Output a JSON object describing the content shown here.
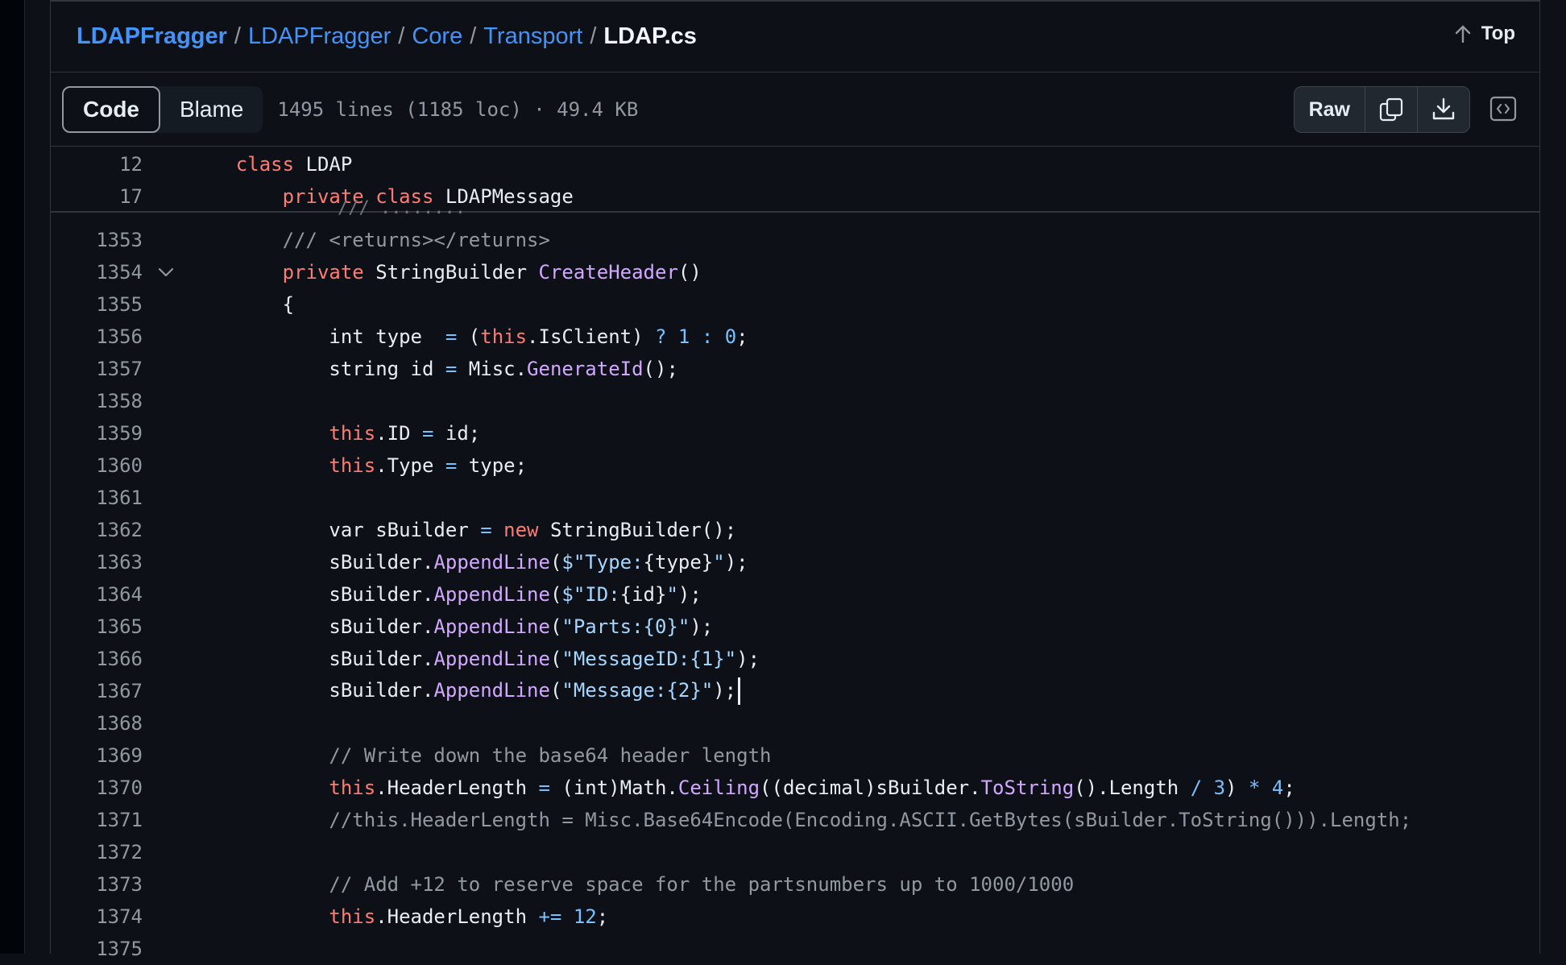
{
  "breadcrumb": {
    "items": [
      "LDAPFragger",
      "LDAPFragger",
      "Core",
      "Transport"
    ],
    "separator": "/",
    "current": "LDAP.cs"
  },
  "top_button": {
    "label": "Top",
    "icon": "arrow-up-icon"
  },
  "toolbar": {
    "tabs": [
      {
        "label": "Code",
        "active": true
      },
      {
        "label": "Blame",
        "active": false
      }
    ],
    "file_meta": "1495 lines (1185 loc) · 49.4 KB",
    "raw_label": "Raw",
    "icons": [
      "copy-icon",
      "download-icon",
      "code-embed-icon"
    ]
  },
  "colors": {
    "background": "#0d1117",
    "link": "#4493f8",
    "keyword": "#ff7b72",
    "function": "#d2a8ff",
    "string": "#a5d6ff",
    "number": "#79c0ff",
    "comment": "#9198a1"
  },
  "sticky_lines": [
    {
      "num": "12",
      "tokens": [
        {
          "t": "    "
        },
        {
          "t": "class",
          "c": "kw"
        },
        {
          "t": " LDAP"
        }
      ]
    },
    {
      "num": "17",
      "tokens": [
        {
          "t": "        "
        },
        {
          "t": "private class",
          "c": "kw"
        },
        {
          "t": " LDAPMessage"
        }
      ]
    }
  ],
  "code_lines": [
    {
      "num": "1353",
      "tokens": [
        {
          "t": "        "
        },
        {
          "t": "/// <returns></returns>",
          "c": "cm"
        }
      ]
    },
    {
      "num": "1354",
      "fold": true,
      "tokens": [
        {
          "t": "        "
        },
        {
          "t": "private",
          "c": "kw"
        },
        {
          "t": " StringBuilder "
        },
        {
          "t": "CreateHeader",
          "c": "fn"
        },
        {
          "t": "()"
        }
      ]
    },
    {
      "num": "1355",
      "tokens": [
        {
          "t": "        {"
        }
      ]
    },
    {
      "num": "1356",
      "tokens": [
        {
          "t": "            int type  "
        },
        {
          "t": "=",
          "c": "op"
        },
        {
          "t": " ("
        },
        {
          "t": "this",
          "c": "kw"
        },
        {
          "t": ".IsClient) "
        },
        {
          "t": "?",
          "c": "op"
        },
        {
          "t": " "
        },
        {
          "t": "1",
          "c": "num"
        },
        {
          "t": " "
        },
        {
          "t": ":",
          "c": "op"
        },
        {
          "t": " "
        },
        {
          "t": "0",
          "c": "num"
        },
        {
          "t": ";"
        }
      ]
    },
    {
      "num": "1357",
      "tokens": [
        {
          "t": "            string id "
        },
        {
          "t": "=",
          "c": "op"
        },
        {
          "t": " Misc."
        },
        {
          "t": "GenerateId",
          "c": "fn"
        },
        {
          "t": "();"
        }
      ]
    },
    {
      "num": "1358",
      "tokens": [
        {
          "t": ""
        }
      ]
    },
    {
      "num": "1359",
      "tokens": [
        {
          "t": "            "
        },
        {
          "t": "this",
          "c": "kw"
        },
        {
          "t": ".ID "
        },
        {
          "t": "=",
          "c": "op"
        },
        {
          "t": " id;"
        }
      ]
    },
    {
      "num": "1360",
      "tokens": [
        {
          "t": "            "
        },
        {
          "t": "this",
          "c": "kw"
        },
        {
          "t": ".Type "
        },
        {
          "t": "=",
          "c": "op"
        },
        {
          "t": " type;"
        }
      ]
    },
    {
      "num": "1361",
      "tokens": [
        {
          "t": ""
        }
      ]
    },
    {
      "num": "1362",
      "tokens": [
        {
          "t": "            var sBuilder "
        },
        {
          "t": "=",
          "c": "op"
        },
        {
          "t": " "
        },
        {
          "t": "new",
          "c": "kw"
        },
        {
          "t": " StringBuilder();"
        }
      ]
    },
    {
      "num": "1363",
      "tokens": [
        {
          "t": "            sBuilder."
        },
        {
          "t": "AppendLine",
          "c": "fn"
        },
        {
          "t": "("
        },
        {
          "t": "$\"Type:",
          "c": "str"
        },
        {
          "t": "{type}"
        },
        {
          "t": "\"",
          "c": "str"
        },
        {
          "t": ");"
        }
      ]
    },
    {
      "num": "1364",
      "tokens": [
        {
          "t": "            sBuilder."
        },
        {
          "t": "AppendLine",
          "c": "fn"
        },
        {
          "t": "("
        },
        {
          "t": "$\"ID:",
          "c": "str"
        },
        {
          "t": "{id}"
        },
        {
          "t": "\"",
          "c": "str"
        },
        {
          "t": ");"
        }
      ]
    },
    {
      "num": "1365",
      "tokens": [
        {
          "t": "            sBuilder."
        },
        {
          "t": "AppendLine",
          "c": "fn"
        },
        {
          "t": "("
        },
        {
          "t": "\"Parts:{0}\"",
          "c": "str"
        },
        {
          "t": ");"
        }
      ]
    },
    {
      "num": "1366",
      "tokens": [
        {
          "t": "            sBuilder."
        },
        {
          "t": "AppendLine",
          "c": "fn"
        },
        {
          "t": "("
        },
        {
          "t": "\"MessageID:{1}\"",
          "c": "str"
        },
        {
          "t": ");"
        }
      ]
    },
    {
      "num": "1367",
      "caret": true,
      "tokens": [
        {
          "t": "            sBuilder."
        },
        {
          "t": "AppendLine",
          "c": "fn"
        },
        {
          "t": "("
        },
        {
          "t": "\"Message:{2}\"",
          "c": "str"
        },
        {
          "t": ");"
        }
      ]
    },
    {
      "num": "1368",
      "tokens": [
        {
          "t": ""
        }
      ]
    },
    {
      "num": "1369",
      "tokens": [
        {
          "t": "            "
        },
        {
          "t": "// Write down the base64 header length",
          "c": "cm"
        }
      ]
    },
    {
      "num": "1370",
      "tokens": [
        {
          "t": "            "
        },
        {
          "t": "this",
          "c": "kw"
        },
        {
          "t": ".HeaderLength "
        },
        {
          "t": "=",
          "c": "op"
        },
        {
          "t": " (int)Math."
        },
        {
          "t": "Ceiling",
          "c": "fn"
        },
        {
          "t": "((decimal)sBuilder."
        },
        {
          "t": "ToString",
          "c": "fn"
        },
        {
          "t": "().Length "
        },
        {
          "t": "/",
          "c": "op"
        },
        {
          "t": " "
        },
        {
          "t": "3",
          "c": "num"
        },
        {
          "t": ") "
        },
        {
          "t": "*",
          "c": "op"
        },
        {
          "t": " "
        },
        {
          "t": "4",
          "c": "num"
        },
        {
          "t": ";"
        }
      ]
    },
    {
      "num": "1371",
      "tokens": [
        {
          "t": "            "
        },
        {
          "t": "//this.HeaderLength = Misc.Base64Encode(Encoding.ASCII.GetBytes(sBuilder.ToString())).Length;",
          "c": "cm"
        }
      ]
    },
    {
      "num": "1372",
      "tokens": [
        {
          "t": ""
        }
      ]
    },
    {
      "num": "1373",
      "tokens": [
        {
          "t": "            "
        },
        {
          "t": "// Add +12 to reserve space for the partsnumbers up to 1000/1000",
          "c": "cm"
        }
      ]
    },
    {
      "num": "1374",
      "tokens": [
        {
          "t": "            "
        },
        {
          "t": "this",
          "c": "kw"
        },
        {
          "t": ".HeaderLength "
        },
        {
          "t": "+=",
          "c": "op"
        },
        {
          "t": " "
        },
        {
          "t": "12",
          "c": "num"
        },
        {
          "t": ";"
        }
      ]
    },
    {
      "num": "1375",
      "tokens": [
        {
          "t": ""
        }
      ]
    }
  ]
}
